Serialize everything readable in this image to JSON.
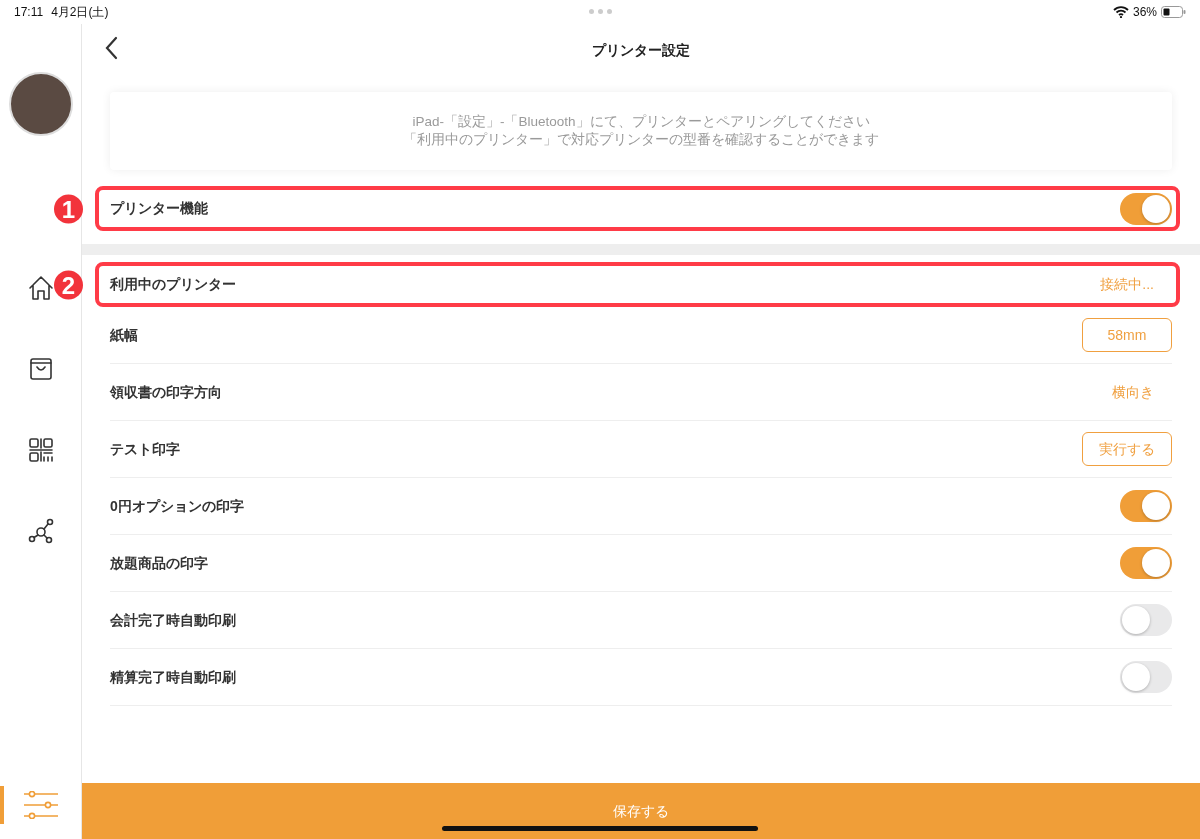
{
  "status_bar": {
    "time": "17:11",
    "date": "4月2日(土)",
    "battery": "36%"
  },
  "sidebar": {
    "items": [
      {
        "kind": "home",
        "selected": false
      },
      {
        "kind": "bag",
        "selected": false
      },
      {
        "kind": "qr",
        "selected": false
      },
      {
        "kind": "network",
        "selected": false
      },
      {
        "kind": "settings",
        "selected": true
      }
    ]
  },
  "header": {
    "title": "プリンター設定"
  },
  "info": [
    "iPad-「設定」-「Bluetooth」にて、プリンターとペアリングしてください",
    "「利用中のプリンター」で対応プリンターの型番を確認することができます"
  ],
  "sections": [
    {
      "rows": [
        {
          "label": "プリンター機能",
          "kind": "toggle",
          "on": true,
          "marker": "1"
        }
      ]
    },
    {
      "rows": [
        {
          "label": "利用中のプリンター",
          "kind": "text",
          "value": "接続中...",
          "marker": "2"
        },
        {
          "label": "紙幅",
          "kind": "button",
          "value": "58mm"
        },
        {
          "label": "領収書の印字方向",
          "kind": "text",
          "value": "横向き"
        },
        {
          "label": "テスト印字",
          "kind": "button",
          "value": "実行する"
        },
        {
          "label": "0円オプションの印字",
          "kind": "toggle",
          "on": true
        },
        {
          "label": "放題商品の印字",
          "kind": "toggle",
          "on": true
        },
        {
          "label": "会計完了時自動印刷",
          "kind": "toggle",
          "on": false
        },
        {
          "label": "精算完了時自動印刷",
          "kind": "toggle",
          "on": false
        }
      ]
    }
  ],
  "save_button": "保存する"
}
